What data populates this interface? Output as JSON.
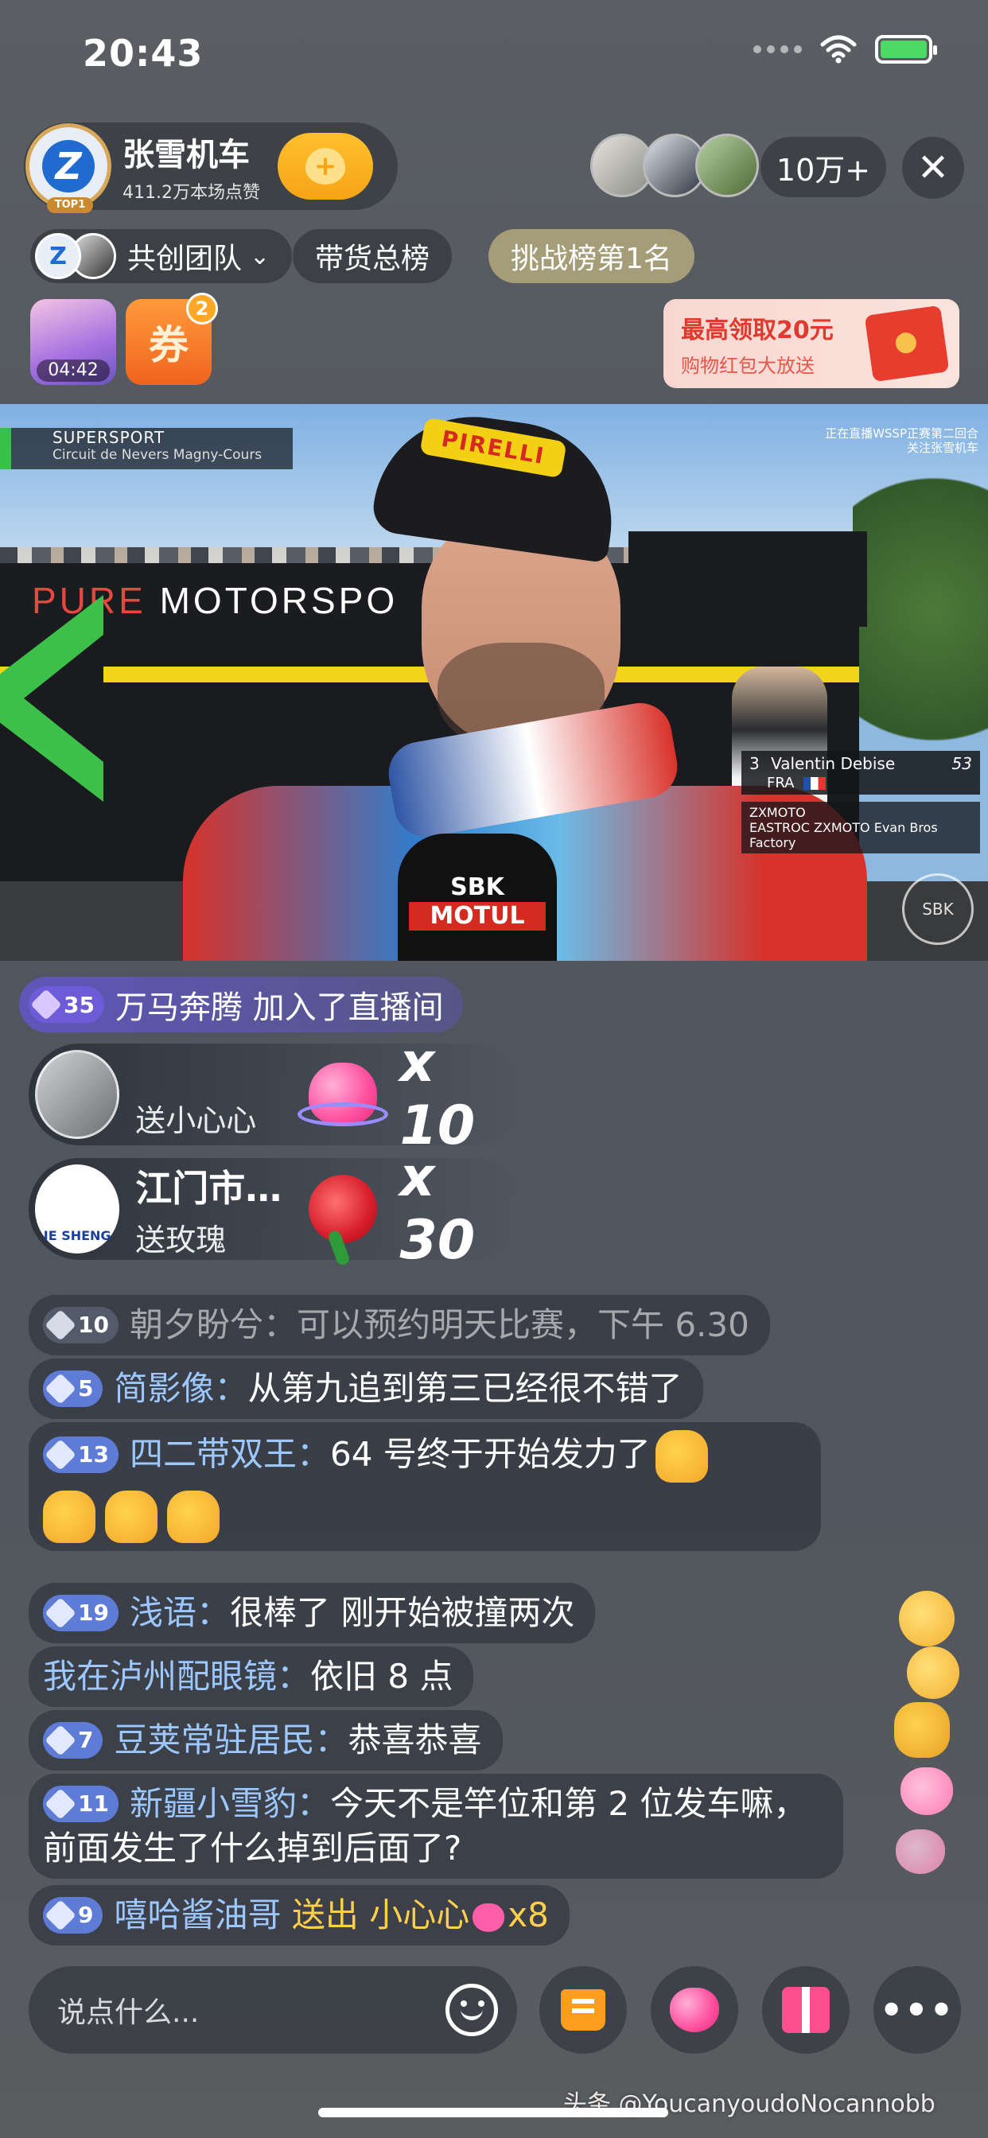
{
  "status_bar": {
    "time": "20:43"
  },
  "host": {
    "name": "张雪机车",
    "likes": "411.2万本场点赞",
    "rank_badge": "TOP1"
  },
  "audience": {
    "count": "10万+"
  },
  "tags": {
    "team": "共创团队",
    "sales": "带货总榜",
    "challenge": "挑战榜第1名"
  },
  "tiles": {
    "timer": "04:42",
    "coupon_label": "券",
    "coupon_badge": "2"
  },
  "red_envelope": {
    "title": "最高领取20元",
    "subtitle": "购物红包大放送"
  },
  "video": {
    "series_label": "SUPERSPORT",
    "circuit": "Circuit de Nevers Magny-Cours",
    "top_right_1": "正在直播WSSP正赛第二回合",
    "top_right_2": "关注张雪机车",
    "wall_pure": "PURE",
    "wall_motorsport": "MOTORSPO",
    "cap_brand": "PIRELLI",
    "mic_top": "SBK",
    "mic_bottom": "MOTUL",
    "rider_pos": "3",
    "rider_name": "Valentin Debise",
    "rider_number": "53",
    "rider_country": "FRA",
    "team_1": "ZXMOTO",
    "team_2": "EASTROC ZXMOTO Evan Bros Factory",
    "corner_logo": "SBK"
  },
  "join": {
    "level": "35",
    "text": "万马奔腾 加入了直播间"
  },
  "gifts": [
    {
      "user": "",
      "action": "送小心心",
      "multiplier": "x 10"
    },
    {
      "user": "江门市…",
      "action": "送玫瑰",
      "multiplier": "x 30",
      "avatar_text": "IE SHENG"
    }
  ],
  "chat": [
    {
      "level": "10",
      "user": "朝夕盼兮：",
      "msg": "可以预约明天比赛，下午 6.30"
    },
    {
      "level": "5",
      "user": "简影像：",
      "msg": "从第九追到第三已经很不错了"
    },
    {
      "level": "13",
      "user": "四二带双王：",
      "msg": "64 号终于开始发力了"
    },
    {
      "level": "19",
      "user": "浅语：",
      "msg": "很棒了 刚开始被撞两次"
    },
    {
      "level": "",
      "user": "我在泸州配眼镜：",
      "msg": "依旧 8 点"
    },
    {
      "level": "7",
      "user": "豆荚常驻居民：",
      "msg": "恭喜恭喜"
    },
    {
      "level": "11",
      "user": "新疆小雪豹：",
      "msg": "今天不是竿位和第 2 位发车嘛，前面发生了什么掉到后面了?"
    },
    {
      "level": "9",
      "user": "嘻哈酱油哥",
      "action": "送出 小心心",
      "count": "x8"
    }
  ],
  "input": {
    "placeholder": "说点什么..."
  },
  "watermark": "头条 @YoucanyoudoNocannobb",
  "colors": {
    "accent_orange": "#f5a416",
    "level_purple": "#6e5bd8",
    "username_blue": "#9cc7ff"
  }
}
